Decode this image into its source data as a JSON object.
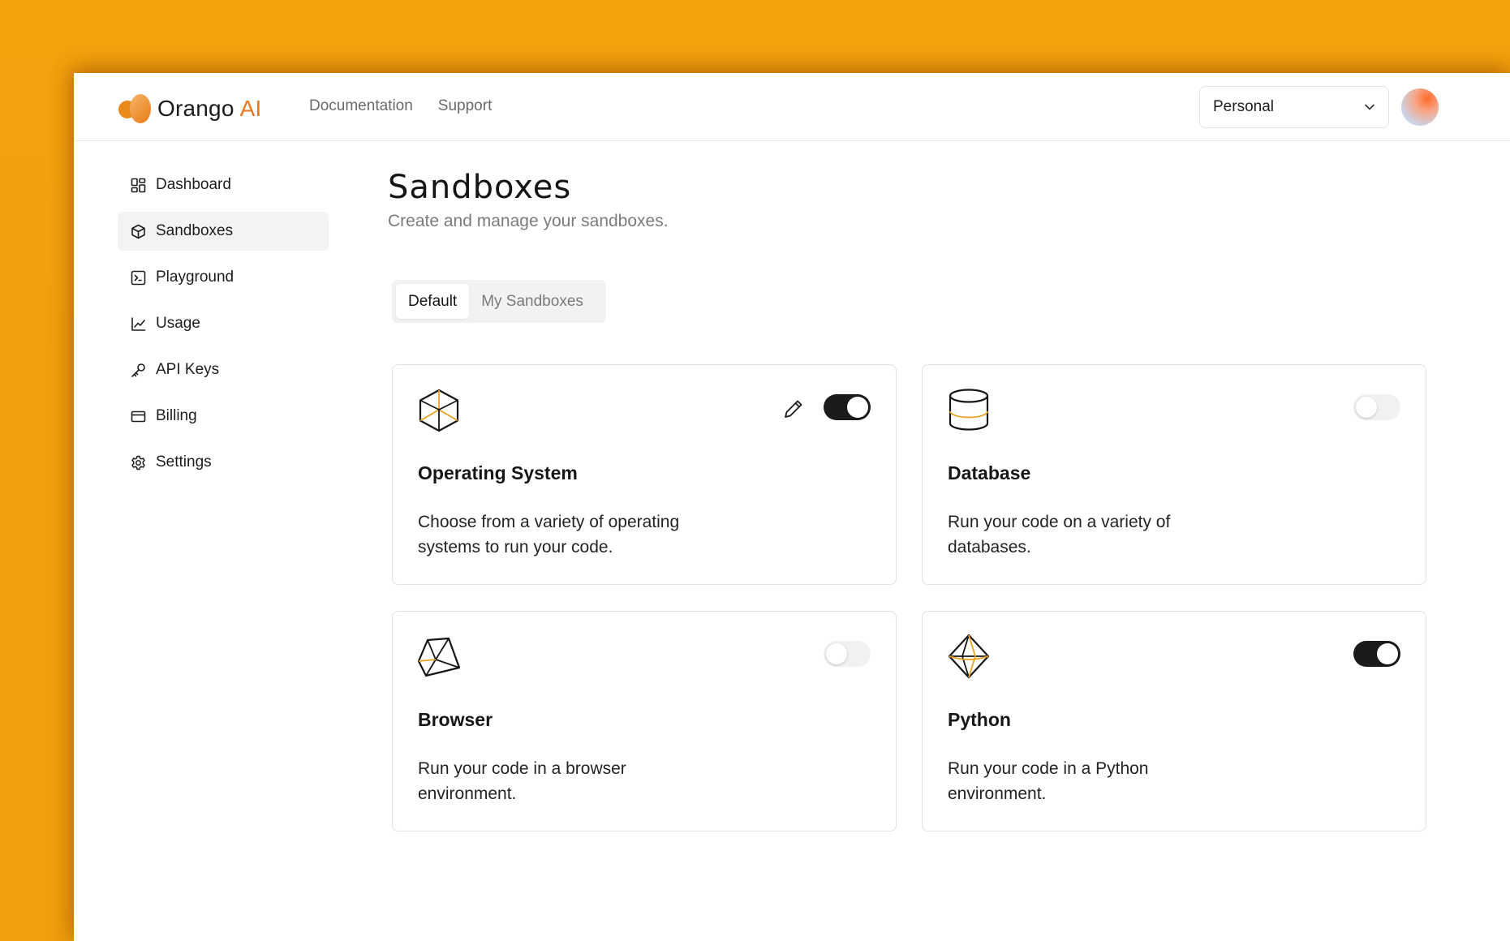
{
  "app": {
    "brand_name": "Orango",
    "brand_suffix": "AI"
  },
  "topnav": {
    "links": [
      "Documentation",
      "Support"
    ],
    "workspace_value": "Personal"
  },
  "sidebar": {
    "items": [
      {
        "label": "Dashboard",
        "icon": "dashboard-icon",
        "active": false
      },
      {
        "label": "Sandboxes",
        "icon": "cube-icon",
        "active": true
      },
      {
        "label": "Playground",
        "icon": "terminal-icon",
        "active": false
      },
      {
        "label": "Usage",
        "icon": "chart-icon",
        "active": false
      },
      {
        "label": "API Keys",
        "icon": "key-icon",
        "active": false
      },
      {
        "label": "Billing",
        "icon": "credit-card-icon",
        "active": false
      },
      {
        "label": "Settings",
        "icon": "gear-icon",
        "active": false
      }
    ]
  },
  "main": {
    "title": "Sandboxes",
    "subtitle": "Create and manage your sandboxes.",
    "tabs": [
      {
        "label": "Default",
        "active": true
      },
      {
        "label": "My Sandboxes",
        "active": false
      }
    ],
    "cards": [
      {
        "title": "Operating System",
        "description": "Choose from a variety of operating systems to run your code.",
        "icon": "cube-wireframe-icon",
        "enabled": true,
        "editable": true
      },
      {
        "title": "Database",
        "description": "Run your code on a variety of databases.",
        "icon": "cylinder-icon",
        "enabled": false,
        "editable": false
      },
      {
        "title": "Browser",
        "description": "Run your code in a browser environment.",
        "icon": "prism-icon",
        "enabled": false,
        "editable": false
      },
      {
        "title": "Python",
        "description": "Run your code in a Python environment.",
        "icon": "octahedron-icon",
        "enabled": true,
        "editable": false
      }
    ]
  },
  "colors": {
    "background": "#f4a20e",
    "accent": "#e8781c",
    "toggle_on": "#1b1b1b"
  }
}
